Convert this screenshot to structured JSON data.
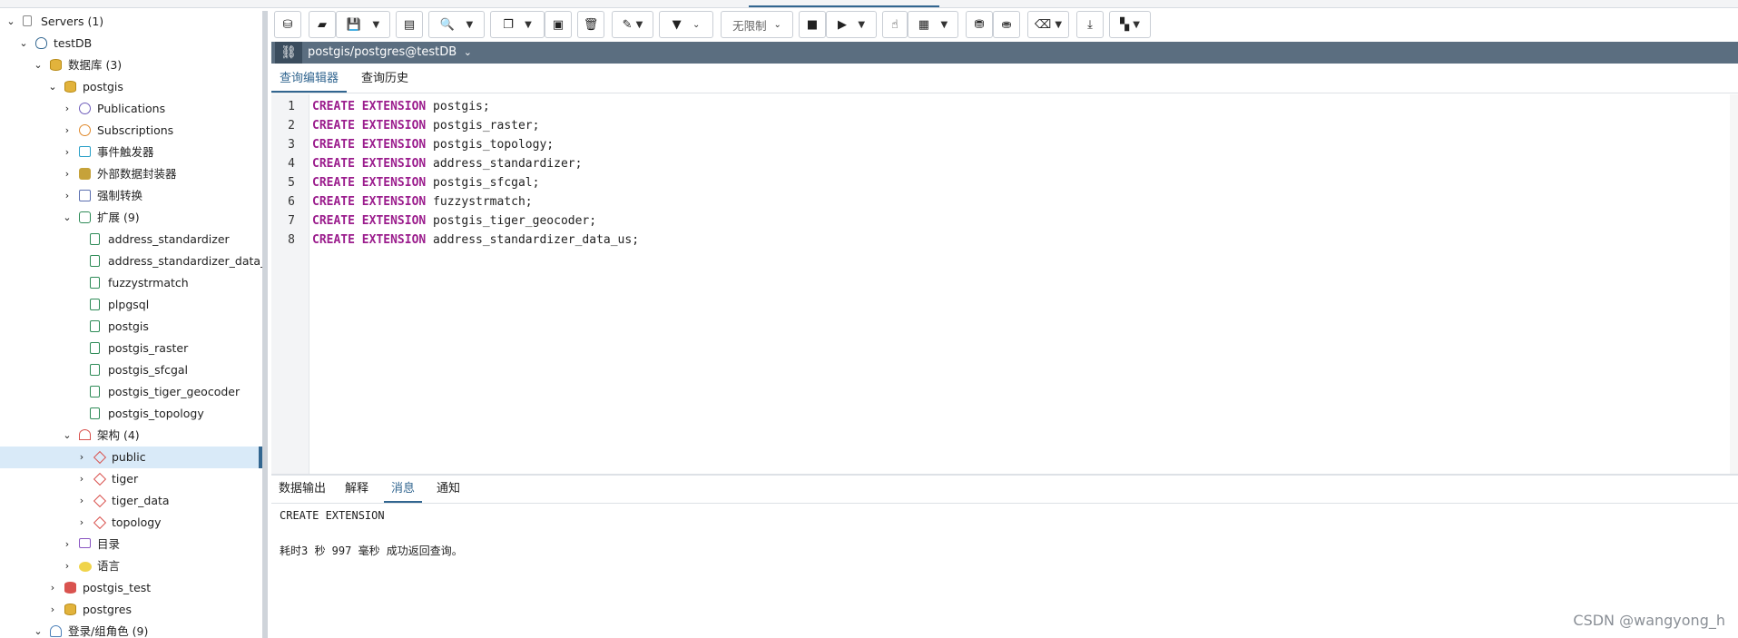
{
  "connection": {
    "label": "postgis/postgres@testDB"
  },
  "tree": [
    {
      "label": "Servers (1)",
      "icon": "server-icon"
    },
    {
      "label": "testDB",
      "icon": "elephant-icon"
    },
    {
      "label": "数据库 (3)",
      "icon": "databases-icon"
    },
    {
      "label": "postgis",
      "icon": "database-icon"
    },
    {
      "label": "Publications",
      "icon": "publication-icon"
    },
    {
      "label": "Subscriptions",
      "icon": "subscription-icon"
    },
    {
      "label": "事件触发器",
      "icon": "event-trigger-icon"
    },
    {
      "label": "外部数据封装器",
      "icon": "fdw-icon"
    },
    {
      "label": "强制转换",
      "icon": "cast-icon"
    },
    {
      "label": "扩展 (9)",
      "icon": "extensions-icon"
    },
    {
      "label": "address_standardizer",
      "icon": "extension-icon"
    },
    {
      "label": "address_standardizer_data_us",
      "icon": "extension-icon"
    },
    {
      "label": "fuzzystrmatch",
      "icon": "extension-icon"
    },
    {
      "label": "plpgsql",
      "icon": "extension-icon"
    },
    {
      "label": "postgis",
      "icon": "extension-icon"
    },
    {
      "label": "postgis_raster",
      "icon": "extension-icon"
    },
    {
      "label": "postgis_sfcgal",
      "icon": "extension-icon"
    },
    {
      "label": "postgis_tiger_geocoder",
      "icon": "extension-icon"
    },
    {
      "label": "postgis_topology",
      "icon": "extension-icon"
    },
    {
      "label": "架构 (4)",
      "icon": "schemas-icon"
    },
    {
      "label": "public",
      "icon": "schema-icon"
    },
    {
      "label": "tiger",
      "icon": "schema-icon"
    },
    {
      "label": "tiger_data",
      "icon": "schema-icon"
    },
    {
      "label": "topology",
      "icon": "schema-icon"
    },
    {
      "label": "目录",
      "icon": "catalog-icon"
    },
    {
      "label": "语言",
      "icon": "language-icon"
    },
    {
      "label": "postgis_test",
      "icon": "database-disconnected-icon"
    },
    {
      "label": "postgres",
      "icon": "database-icon"
    },
    {
      "label": "登录/组角色 (9)",
      "icon": "roles-icon"
    }
  ],
  "toolbar": {
    "limit_label": "无限制",
    "icons": [
      "database-icon",
      "open-file-icon",
      "save-icon",
      "chevron-down-icon",
      "save-data-icon",
      "search-icon",
      "chevron-down-icon",
      "copy-icon",
      "chevron-down-icon",
      "paste-icon",
      "delete-icon",
      "edit-icon",
      "filter-icon",
      "chevron-down-icon",
      "stop-icon",
      "execute-icon",
      "chevron-down-icon",
      "explain-icon",
      "explain-analyze-icon",
      "chevron-down-icon",
      "commit-icon",
      "rollback-icon",
      "clear-icon",
      "download-icon",
      "macros-icon"
    ]
  },
  "editor_tabs": [
    "查询编辑器",
    "查询历史"
  ],
  "editor": {
    "lines": [
      {
        "n": "1",
        "kw": "CREATE EXTENSION",
        "rest": " postgis;"
      },
      {
        "n": "2",
        "kw": "CREATE EXTENSION",
        "rest": " postgis_raster;"
      },
      {
        "n": "3",
        "kw": "CREATE EXTENSION",
        "rest": " postgis_topology;"
      },
      {
        "n": "4",
        "kw": "CREATE EXTENSION",
        "rest": " address_standardizer;"
      },
      {
        "n": "5",
        "kw": "CREATE EXTENSION",
        "rest": " postgis_sfcgal;"
      },
      {
        "n": "6",
        "kw": "CREATE EXTENSION",
        "rest": " fuzzystrmatch;"
      },
      {
        "n": "7",
        "kw": "CREATE EXTENSION",
        "rest": " postgis_tiger_geocoder;"
      },
      {
        "n": "8",
        "kw": "CREATE EXTENSION",
        "rest": " address_standardizer_data_us;"
      }
    ]
  },
  "output_tabs": [
    "数据输出",
    "解释",
    "消息",
    "通知"
  ],
  "messages": {
    "line1": "CREATE EXTENSION",
    "line2": "耗时3 秒 997 毫秒 成功返回查询。"
  },
  "watermark": "CSDN @wangyong_h",
  "colors": {
    "accent": "#326690",
    "keyword": "#9b1d8d",
    "connbar": "#5b6e80"
  }
}
